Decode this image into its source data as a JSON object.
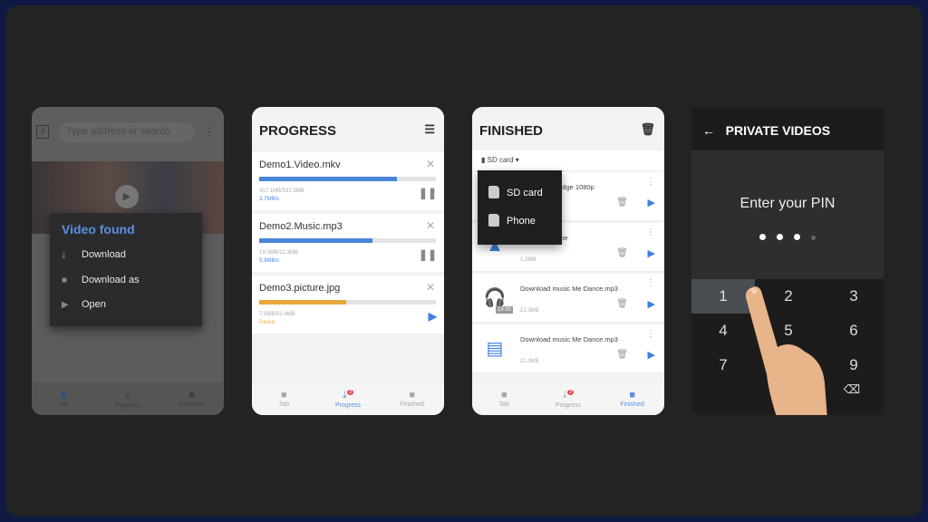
{
  "browser_screen": {
    "tab_count": "3",
    "address_placeholder": "Type address or search",
    "popup": {
      "title": "Video found",
      "items": [
        {
          "icon": "download-icon",
          "label": "Download"
        },
        {
          "icon": "folder-icon",
          "label": "Download as"
        },
        {
          "icon": "play-icon",
          "label": "Open"
        }
      ]
    },
    "nav": [
      "Tab",
      "Progress",
      "Finished"
    ]
  },
  "progress_screen": {
    "title": "PROGRESS",
    "items": [
      {
        "name": "Demo1.Video.mkv",
        "size": "417.1MB/531.9MB",
        "status": "3.7MB/s",
        "progress": 0.78,
        "color": "#4a86d8",
        "action": "pause"
      },
      {
        "name": "Demo2.Music.mp3",
        "size": "19.3MB/21.3MB",
        "status": "5.9MB/s",
        "progress": 0.64,
        "color": "#4a86d8",
        "action": "pause"
      },
      {
        "name": "Demo3.picture.jpg",
        "size": "7.5MB/31.9MB",
        "status": "Pause",
        "progress": 0.49,
        "color": "#e8a93a",
        "action": "play"
      }
    ],
    "nav": [
      "Tab",
      "Progress",
      "Finished"
    ],
    "badge": "3"
  },
  "finished_screen": {
    "title": "FINISHED",
    "storage": "SD card",
    "dropdown": [
      "SD card",
      "Phone"
    ],
    "items": [
      {
        "name": "Downloads Ridge 1080p",
        "size": "",
        "icon": "video-icon"
      },
      {
        "name": "Picture I am the",
        "size": "1.2MB",
        "icon": "image-icon"
      },
      {
        "name": "Download music Me Dance.mp3",
        "size": "21.3MB",
        "icon": "headphones-icon",
        "duration": "19:30"
      },
      {
        "name": "Download music Me Dance.mp3",
        "size": "21.3MB",
        "icon": "document-icon"
      }
    ],
    "nav": [
      "Tab",
      "Progress",
      "Finished"
    ],
    "badge": "3"
  },
  "pin_screen": {
    "title": "PRIVATE VIDEOS",
    "prompt": "Enter your PIN",
    "entered": 3,
    "length": 4,
    "keys": [
      "1",
      "2",
      "3",
      "4",
      "5",
      "6",
      "7",
      "9"
    ]
  }
}
